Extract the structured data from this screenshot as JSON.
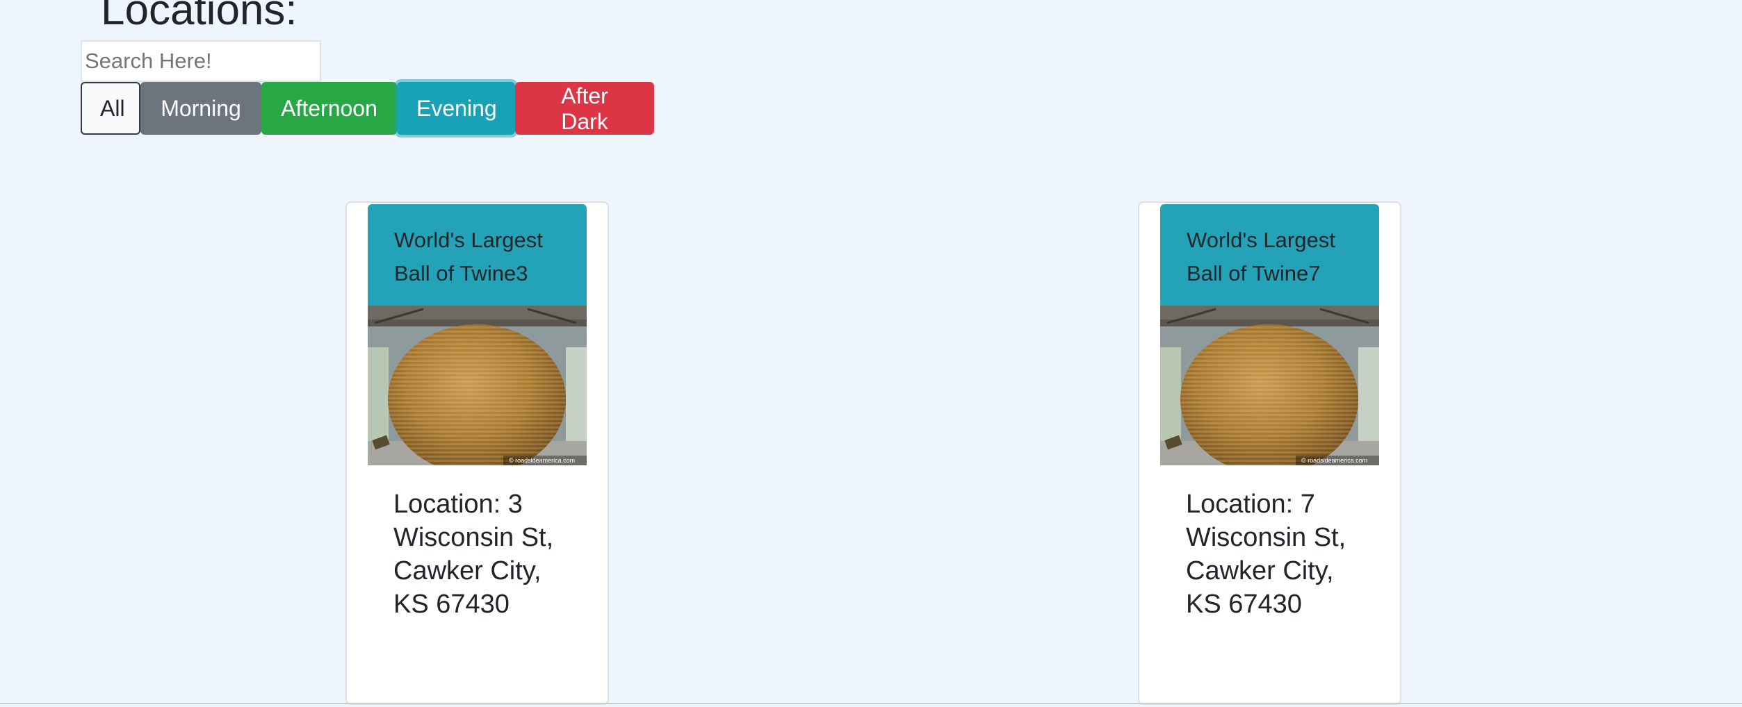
{
  "header": {
    "title": "Locations:"
  },
  "search": {
    "placeholder": "Search Here!",
    "value": ""
  },
  "filters": [
    {
      "label": "All",
      "color": "#f8f9fa"
    },
    {
      "label": "Morning",
      "color": "#6c757d"
    },
    {
      "label": "Afternoon",
      "color": "#28a745"
    },
    {
      "label": "Evening",
      "color": "#17a2b8"
    },
    {
      "label": "After Dark",
      "color": "#dc3545"
    }
  ],
  "cards": [
    {
      "title": "World's Largest Ball of Twine3",
      "image_icon": "twine-ball-photo",
      "image_credit": "© roadsideamerica.com",
      "location_prefix": "Location: 3",
      "location_rest": "Wisconsin St, Cawker City, KS 67430"
    },
    {
      "title": "World's Largest Ball of Twine7",
      "image_icon": "twine-ball-photo",
      "image_credit": "© roadsideamerica.com",
      "location_prefix": "Location: 7",
      "location_rest": "Wisconsin St, Cawker City, KS 67430"
    }
  ],
  "colors": {
    "background": "#eef5fd",
    "card_header": "#24a3b8"
  }
}
